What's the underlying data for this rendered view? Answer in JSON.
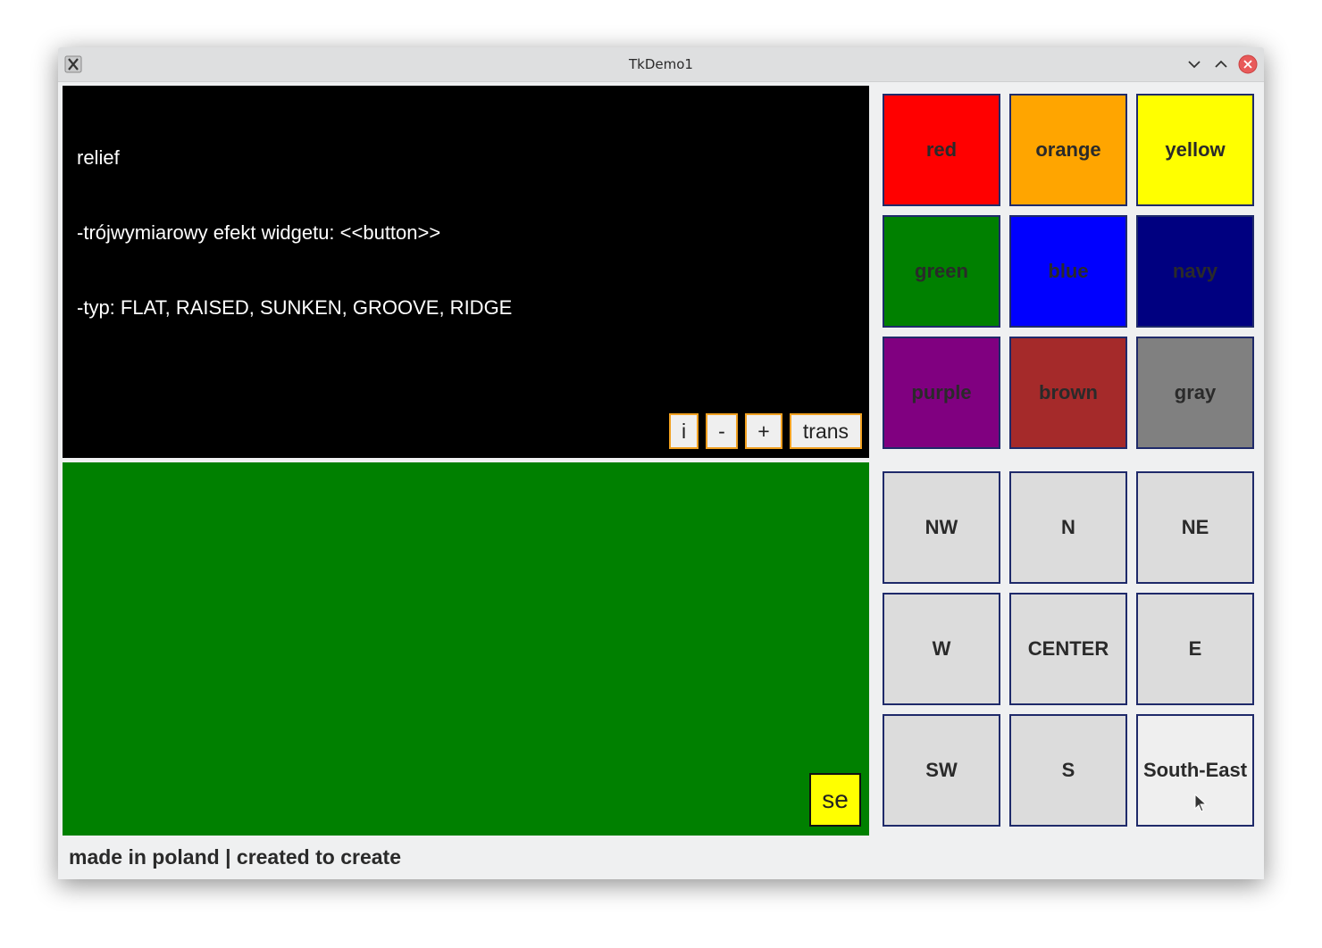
{
  "window": {
    "title": "TkDemo1"
  },
  "text_panel": {
    "lines": [
      "relief",
      "-trójwymiarowy efekt widgetu: <<button>>",
      "-typ: FLAT, RAISED, SUNKEN, GROOVE, RIDGE"
    ],
    "background": "#000000",
    "text_color": "#ffffff",
    "buttons": {
      "i": "i",
      "minus": "-",
      "plus": "+",
      "trans": "trans"
    }
  },
  "green_panel": {
    "background": "#008000",
    "se_label": "se",
    "se_color": "#ffff00"
  },
  "color_buttons": [
    {
      "label": "red",
      "color": "#ff0000"
    },
    {
      "label": "orange",
      "color": "#ffa500"
    },
    {
      "label": "yellow",
      "color": "#ffff00"
    },
    {
      "label": "green",
      "color": "#008000"
    },
    {
      "label": "blue",
      "color": "#0000ff"
    },
    {
      "label": "navy",
      "color": "#000080"
    },
    {
      "label": "purple",
      "color": "#800080"
    },
    {
      "label": "brown",
      "color": "#a52a2a"
    },
    {
      "label": "gray",
      "color": "#808080"
    }
  ],
  "anchor_buttons": [
    {
      "label": "NW"
    },
    {
      "label": "N"
    },
    {
      "label": "NE"
    },
    {
      "label": "W"
    },
    {
      "label": "CENTER"
    },
    {
      "label": "E"
    },
    {
      "label": "SW"
    },
    {
      "label": "S"
    },
    {
      "label": "South-East",
      "highlighted": true
    }
  ],
  "status": {
    "text": "made in poland | created to create"
  }
}
